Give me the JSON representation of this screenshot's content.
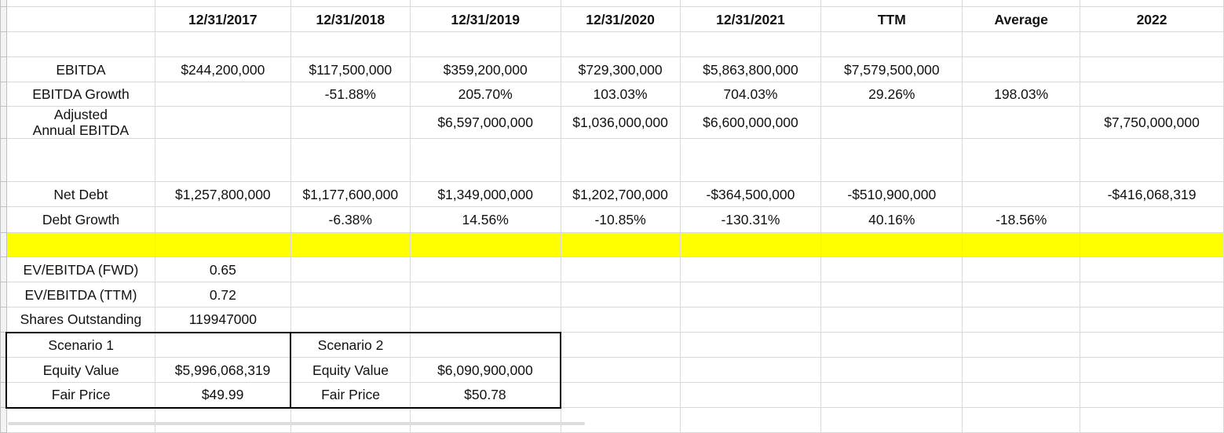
{
  "sheet": {
    "columns": [
      "",
      "12/31/2017",
      "12/31/2018",
      "12/31/2019",
      "12/31/2020",
      "12/31/2021",
      "TTM",
      "Average",
      "2022"
    ],
    "rows": [
      {
        "name": "blank-row",
        "cells": [
          "",
          "",
          "",
          "",
          "",
          "",
          "",
          "",
          ""
        ]
      },
      {
        "name": "ebitda-row",
        "cells": [
          "EBITDA",
          "$244,200,000",
          "$117,500,000",
          "$359,200,000",
          "$729,300,000",
          "$5,863,800,000",
          "$7,579,500,000",
          "",
          ""
        ]
      },
      {
        "name": "ebitda-growth-row",
        "cells": [
          "EBITDA Growth",
          "",
          "-51.88%",
          "205.70%",
          "103.03%",
          "704.03%",
          "29.26%",
          "198.03%",
          ""
        ]
      },
      {
        "name": "adjusted-annual-ebitda-row",
        "cells": [
          "Adjusted\nAnnual EBITDA",
          "",
          "",
          "$6,597,000,000",
          "$1,036,000,000",
          "$6,600,000,000",
          "",
          "",
          "$7,750,000,000"
        ]
      },
      {
        "name": "blank-row",
        "cells": [
          "",
          "",
          "",
          "",
          "",
          "",
          "",
          "",
          ""
        ]
      },
      {
        "name": "net-debt-row",
        "cells": [
          "Net Debt",
          "$1,257,800,000",
          "$1,177,600,000",
          "$1,349,000,000",
          "$1,202,700,000",
          "-$364,500,000",
          "-$510,900,000",
          "",
          "-$416,068,319"
        ]
      },
      {
        "name": "debt-growth-row",
        "cells": [
          "Debt Growth",
          "",
          "-6.38%",
          "14.56%",
          "-10.85%",
          "-130.31%",
          "40.16%",
          "-18.56%",
          ""
        ]
      },
      {
        "name": "yellow-separator-row",
        "cells": [
          "",
          "",
          "",
          "",
          "",
          "",
          "",
          "",
          ""
        ]
      },
      {
        "name": "ev-ebitda-fwd-row",
        "cells": [
          "EV/EBITDA (FWD)",
          "0.65",
          "",
          "",
          "",
          "",
          "",
          "",
          ""
        ]
      },
      {
        "name": "ev-ebitda-ttm-row",
        "cells": [
          "EV/EBITDA (TTM)",
          "0.72",
          "",
          "",
          "",
          "",
          "",
          "",
          ""
        ]
      },
      {
        "name": "shares-outstanding-row",
        "cells": [
          "Shares Outstanding",
          "119947000",
          "",
          "",
          "",
          "",
          "",
          "",
          ""
        ]
      },
      {
        "name": "scenario-row",
        "cells": [
          "Scenario 1",
          "",
          "Scenario 2",
          "",
          "",
          "",
          "",
          "",
          ""
        ]
      },
      {
        "name": "equity-value-row",
        "cells": [
          "Equity Value",
          "$5,996,068,319",
          "Equity Value",
          "$6,090,900,000",
          "",
          "",
          "",
          "",
          ""
        ]
      },
      {
        "name": "fair-price-row",
        "cells": [
          "Fair Price",
          "$49.99",
          "Fair Price",
          "$50.78",
          "",
          "",
          "",
          "",
          ""
        ]
      },
      {
        "name": "blank-row",
        "cells": [
          "",
          "",
          "",
          "",
          "",
          "",
          "",
          "",
          ""
        ]
      }
    ]
  },
  "colors": {
    "highlight": "#ffff00",
    "grid": "#d9d9d9",
    "border": "#000000"
  }
}
